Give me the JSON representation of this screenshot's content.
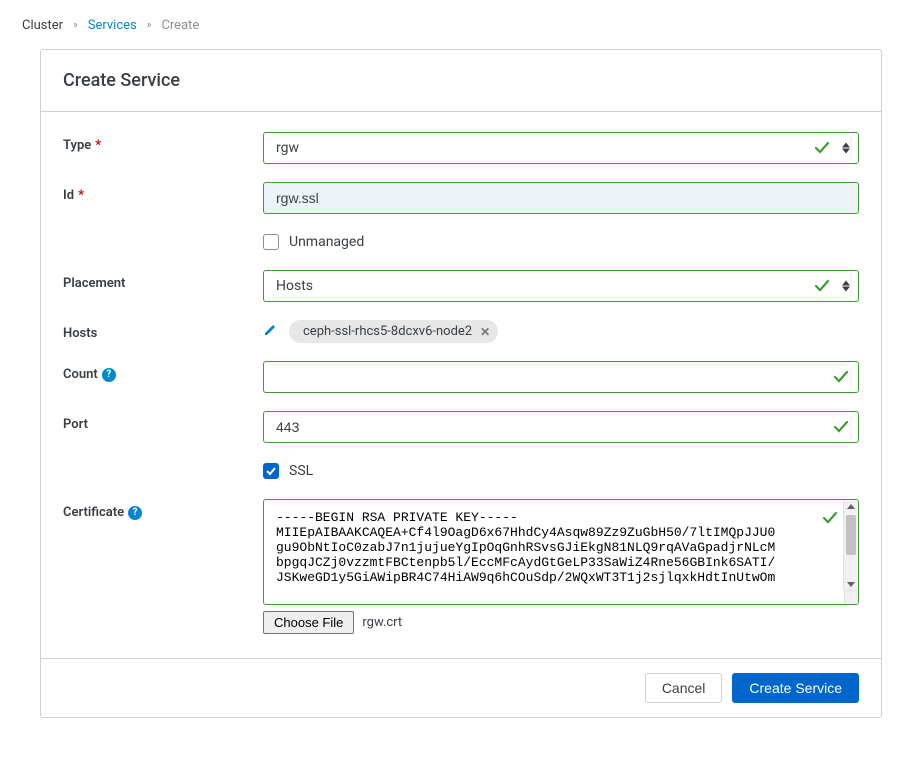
{
  "breadcrumb": {
    "cluster": "Cluster",
    "services": "Services",
    "create": "Create"
  },
  "header": {
    "title": "Create Service"
  },
  "form": {
    "type": {
      "label": "Type",
      "value": "rgw"
    },
    "id": {
      "label": "Id",
      "value": "rgw.ssl"
    },
    "unmanaged": {
      "label": "Unmanaged",
      "checked": false
    },
    "placement": {
      "label": "Placement",
      "value": "Hosts"
    },
    "hosts": {
      "label": "Hosts",
      "tag": "ceph-ssl-rhcs5-8dcxv6-node2"
    },
    "count": {
      "label": "Count",
      "value": ""
    },
    "port": {
      "label": "Port",
      "value": "443"
    },
    "ssl": {
      "label": "SSL",
      "checked": true
    },
    "certificate": {
      "label": "Certificate",
      "value": "-----BEGIN RSA PRIVATE KEY-----\nMIIEpAIBAAKCAQEA+Cf4l9OagD6x67HhdCy4Asqw89Zz9ZuGbH50/7ltIMQpJJU0\ngu9ObNtIoC0zabJ7n1jujueYgIpOqGnhRSvsGJiEkgN81NLQ9rqAVaGpadjrNLcM\nbpgqJCZj0vzzmtFBCtenpb5l/EccMFcAydGtGeLP33SaWiZ4Rne56GBInk6SATI/\nJSKweGD1y5GiAWipBR4C74HiAW9q6hCOuSdp/2WQxWT3T1j2sjlqxkHdtInUtwOm",
      "file_button": "Choose File",
      "file_name": "rgw.crt"
    }
  },
  "footer": {
    "cancel": "Cancel",
    "submit": "Create Service"
  }
}
